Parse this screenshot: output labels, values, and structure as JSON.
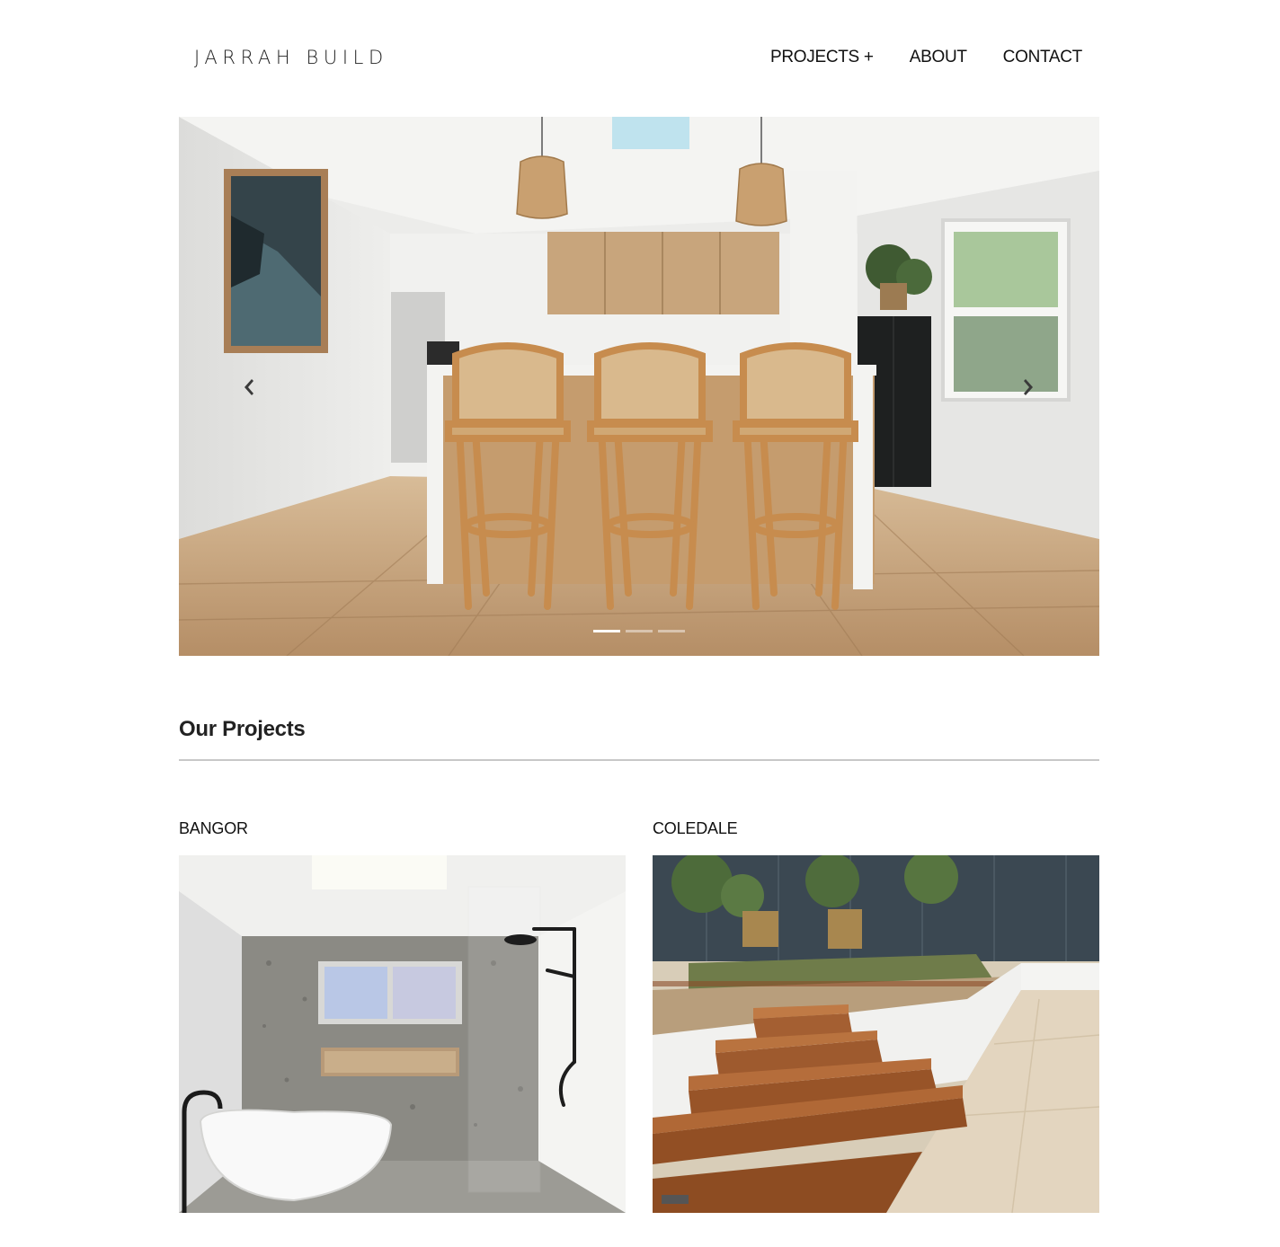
{
  "header": {
    "logo_text": "JARRAH BUILD",
    "nav": [
      {
        "label": "PROJECTS +"
      },
      {
        "label": "ABOUT"
      },
      {
        "label": "CONTACT"
      }
    ]
  },
  "carousel": {
    "slide_count": 3,
    "active_index": 0,
    "prev_icon": "chevron-left-icon",
    "next_icon": "chevron-right-icon"
  },
  "projects_section": {
    "title": "Our Projects",
    "items": [
      {
        "label": "BANGOR"
      },
      {
        "label": "COLEDALE"
      }
    ]
  },
  "colors": {
    "background": "#ffffff",
    "text": "#111111",
    "divider": "#c8c8c8"
  }
}
